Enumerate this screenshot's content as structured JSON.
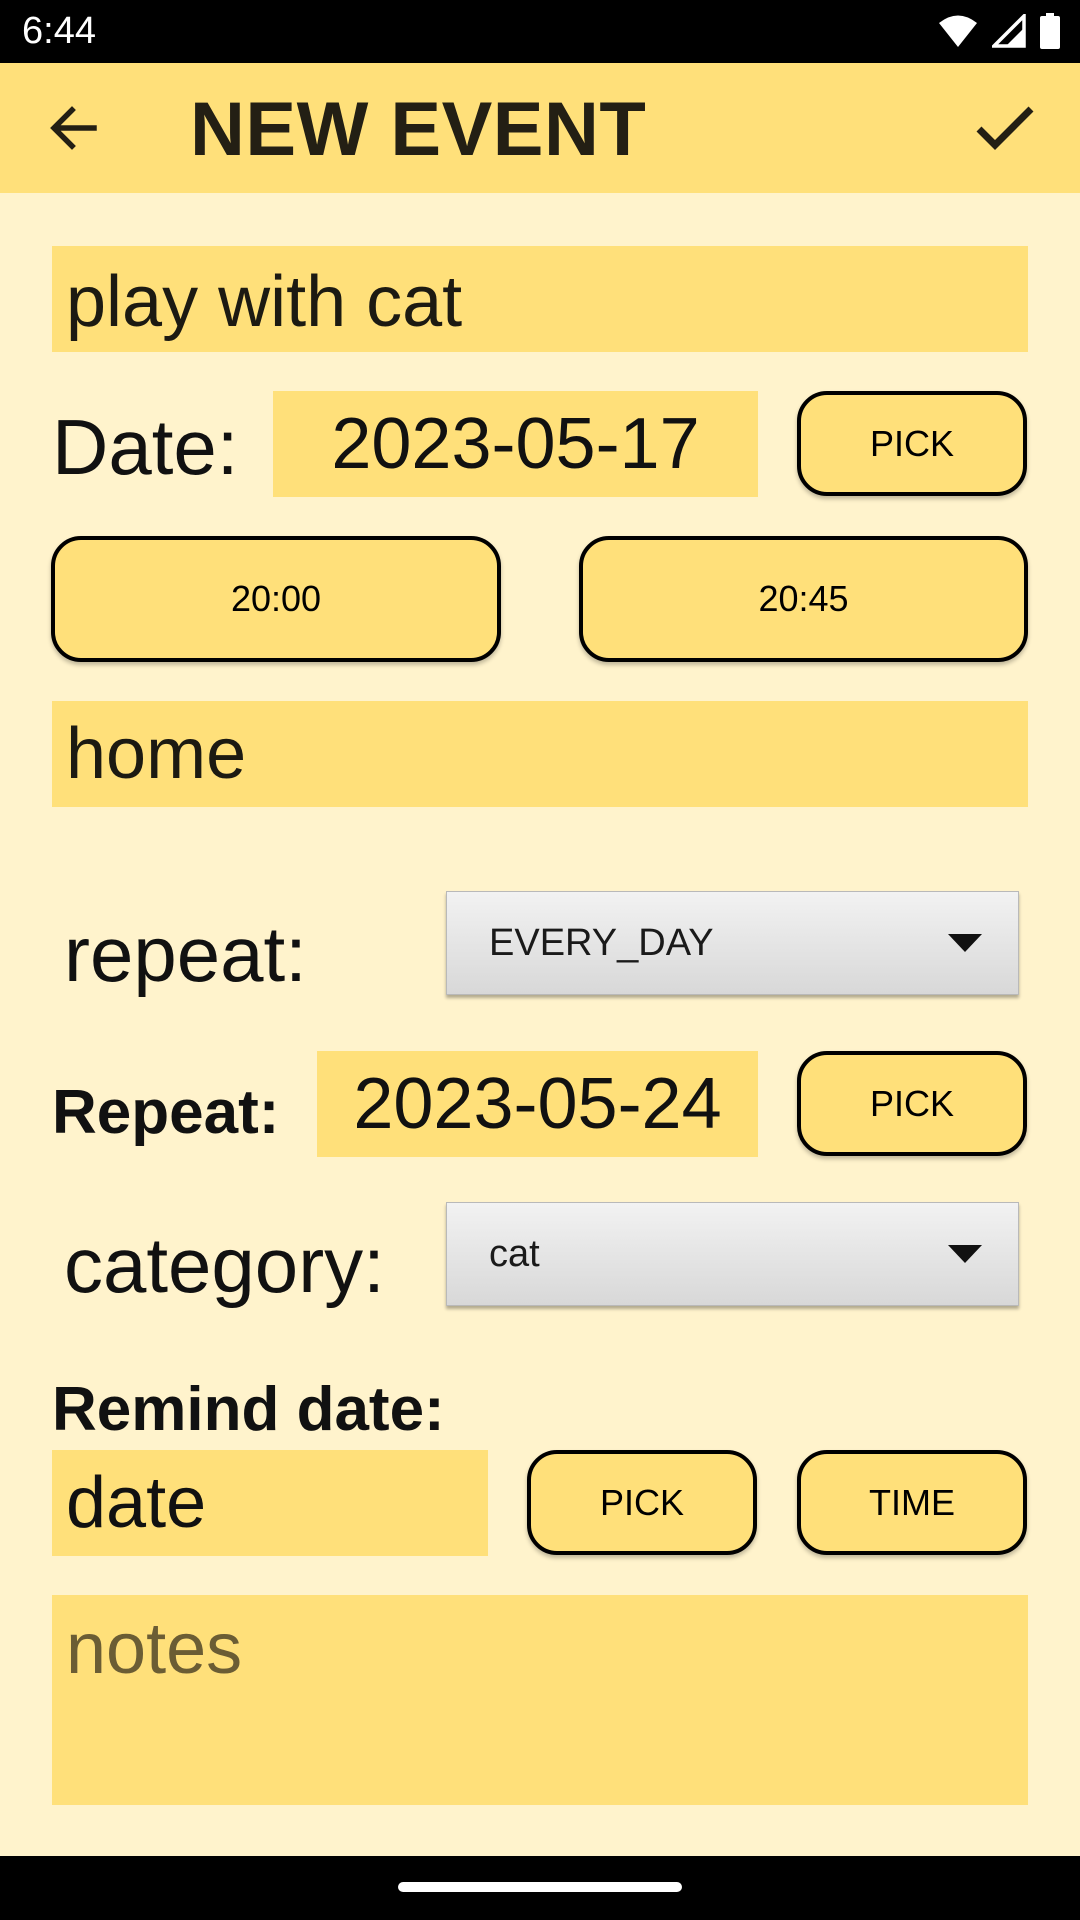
{
  "status_bar": {
    "time": "6:44"
  },
  "app_bar": {
    "title": "NEW EVENT"
  },
  "event": {
    "title_value": "play with cat",
    "date_label": "Date:",
    "date_value": "2023-05-17",
    "date_pick_label": "PICK",
    "start_time": "20:00",
    "end_time": "20:45",
    "location_value": "home",
    "repeat_label": "repeat:",
    "repeat_selected": "EVERY_DAY",
    "repeat_until_label": "Repeat:",
    "repeat_until_value": "2023-05-24",
    "repeat_pick_label": "PICK",
    "category_label": "category:",
    "category_selected": "cat",
    "remind_label": "Remind date:",
    "remind_date_placeholder": "date",
    "remind_pick_label": "PICK",
    "remind_time_label": "TIME",
    "notes_placeholder": "notes"
  },
  "colors": {
    "background": "#FFF3CC",
    "field": "#FFE07A",
    "app_bar": "#FFE07A"
  },
  "icons": {
    "back": "arrow-left-icon",
    "save": "check-icon",
    "wifi": "wifi-icon",
    "signal": "signal-icon",
    "battery": "battery-icon"
  }
}
